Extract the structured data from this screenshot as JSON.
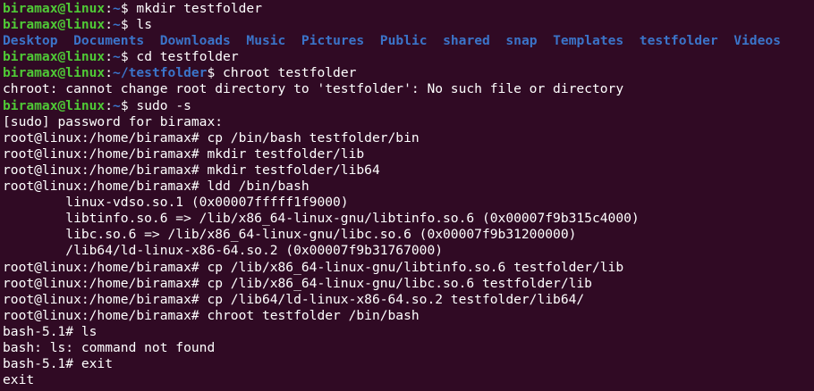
{
  "colors": {
    "background": "#300a24",
    "text": "#ffffff",
    "prompt_user": "#4fc936",
    "prompt_path": "#3b74c9",
    "directory": "#3b74c9"
  },
  "lines": [
    {
      "kind": "prompt",
      "user": "biramax@linux",
      "path": "~",
      "cmd": "mkdir testfolder"
    },
    {
      "kind": "prompt",
      "user": "biramax@linux",
      "path": "~",
      "cmd": "ls"
    },
    {
      "kind": "ls",
      "dirs": [
        "Desktop",
        "Documents",
        "Downloads",
        "Music",
        "Pictures",
        "Public",
        "shared",
        "snap",
        "Templates",
        "testfolder",
        "Videos"
      ]
    },
    {
      "kind": "prompt",
      "user": "biramax@linux",
      "path": "~",
      "cmd": "cd testfolder"
    },
    {
      "kind": "prompt",
      "user": "biramax@linux",
      "path": "~/testfolder",
      "cmd": "chroot testfolder"
    },
    {
      "kind": "text",
      "text": "chroot: cannot change root directory to 'testfolder': No such file or directory"
    },
    {
      "kind": "prompt",
      "user": "biramax@linux",
      "path": "~",
      "cmd": "sudo -s"
    },
    {
      "kind": "text",
      "text": "[sudo] password for biramax:"
    },
    {
      "kind": "text",
      "text": "root@linux:/home/biramax# cp /bin/bash testfolder/bin"
    },
    {
      "kind": "text",
      "text": "root@linux:/home/biramax# mkdir testfolder/lib"
    },
    {
      "kind": "text",
      "text": "root@linux:/home/biramax# mkdir testfolder/lib64"
    },
    {
      "kind": "text",
      "text": "root@linux:/home/biramax# ldd /bin/bash"
    },
    {
      "kind": "text",
      "text": "\tlinux-vdso.so.1 (0x00007fffff1f9000)"
    },
    {
      "kind": "text",
      "text": "\tlibtinfo.so.6 => /lib/x86_64-linux-gnu/libtinfo.so.6 (0x00007f9b315c4000)"
    },
    {
      "kind": "text",
      "text": "\tlibc.so.6 => /lib/x86_64-linux-gnu/libc.so.6 (0x00007f9b31200000)"
    },
    {
      "kind": "text",
      "text": "\t/lib64/ld-linux-x86-64.so.2 (0x00007f9b31767000)"
    },
    {
      "kind": "text",
      "text": "root@linux:/home/biramax# cp /lib/x86_64-linux-gnu/libtinfo.so.6 testfolder/lib"
    },
    {
      "kind": "text",
      "text": "root@linux:/home/biramax# cp /lib/x86_64-linux-gnu/libc.so.6 testfolder/lib"
    },
    {
      "kind": "text",
      "text": "root@linux:/home/biramax# cp /lib64/ld-linux-x86-64.so.2 testfolder/lib64/"
    },
    {
      "kind": "text",
      "text": "root@linux:/home/biramax# chroot testfolder /bin/bash"
    },
    {
      "kind": "text",
      "text": "bash-5.1# ls"
    },
    {
      "kind": "text",
      "text": "bash: ls: command not found"
    },
    {
      "kind": "text",
      "text": "bash-5.1# exit"
    },
    {
      "kind": "text",
      "text": "exit"
    }
  ]
}
